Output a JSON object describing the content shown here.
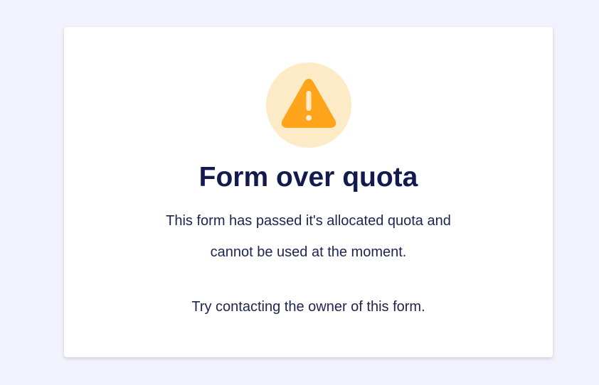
{
  "card": {
    "icon": "warning-triangle-icon",
    "icon_color": "#ffa41b",
    "icon_bg_color": "#fdebc8",
    "title": "Form over quota",
    "description_line1": "This form has passed it's allocated quota and",
    "description_line2": "cannot be used at the moment.",
    "hint": "Try contacting the owner of this form."
  },
  "colors": {
    "page_background": "#f1f2fc",
    "card_background": "#ffffff",
    "title_text": "#121a4f",
    "body_text": "#1d2450"
  }
}
